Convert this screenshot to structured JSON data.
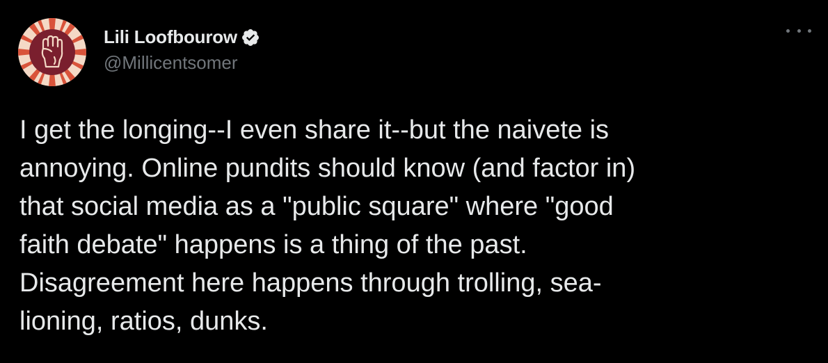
{
  "author": {
    "display_name": "Lili Loofbourow",
    "handle": "@Millicentsomer",
    "verified": true,
    "avatar_icon": "raised-fist-icon"
  },
  "tweet": {
    "lines": [
      "I get the longing--I even share it--but the naivete is",
      "annoying. Online pundits should know (and factor in)",
      "that social media as a \"public square\" where \"good",
      "faith debate\" happens is a thing of the past.",
      "Disagreement here happens through trolling, sea-",
      "lioning, ratios, dunks."
    ]
  },
  "menu": {
    "icon": "more-options-icon"
  },
  "colors": {
    "background": "#000000",
    "text_primary": "#e7e9ea",
    "text_secondary": "#71767b",
    "verified_badge": "#e7e9ea",
    "avatar_bg": "#f4d9c6",
    "avatar_rays": "#d9533a",
    "avatar_circle": "#7a1f2e"
  }
}
